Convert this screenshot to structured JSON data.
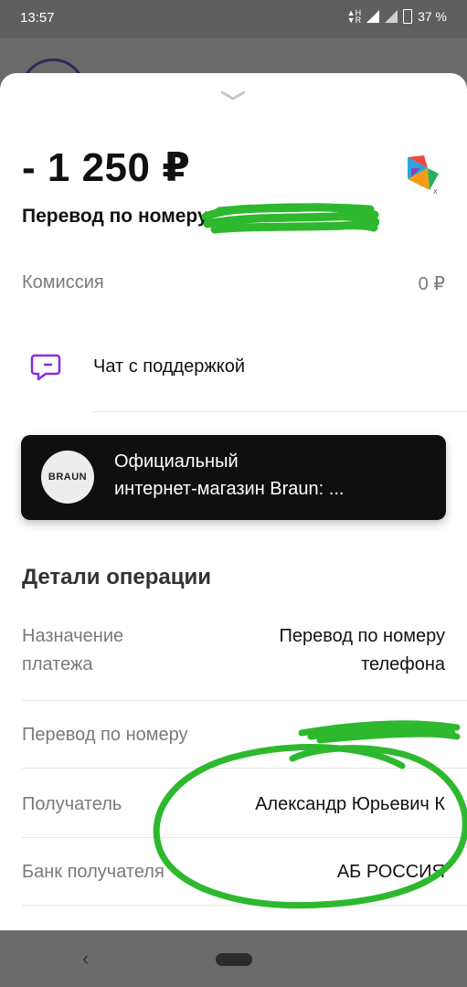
{
  "status_bar": {
    "time": "13:57",
    "battery": "37 %"
  },
  "transaction": {
    "amount": "- 1 250 ₽",
    "title": "Перевод по номеру"
  },
  "commission": {
    "label": "Комиссия",
    "value": "0 ₽"
  },
  "support": {
    "label": "Чат с поддержкой"
  },
  "banner": {
    "logo_text": "BRAUN",
    "line1": "Официальный",
    "line2": "интернет-магазин Braun: ..."
  },
  "details": {
    "title": "Детали операции",
    "rows": [
      {
        "label_line1": "Назначение",
        "label_line2": "платежа",
        "value_line1": "Перевод по номеру",
        "value_line2": "телефона"
      },
      {
        "label": "Перевод по номеру",
        "value": ""
      },
      {
        "label": "Получатель",
        "value": "Александр Юрьевич К"
      },
      {
        "label": "Банк получателя",
        "value": "АБ РОССИЯ"
      }
    ]
  },
  "colors": {
    "accent_purple": "#8a2be2",
    "scribble_green": "#2db82d",
    "banner_bg": "#0f0f0f"
  },
  "icons": {
    "handle": "chevron-down-icon",
    "chat": "chat-bubble-icon",
    "nav_back": "back-arrow-icon",
    "nav_home": "home-pill-icon"
  }
}
